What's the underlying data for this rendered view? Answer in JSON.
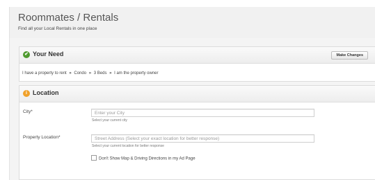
{
  "header": {
    "title": "Roommates / Rentals",
    "subtitle": "Find all your Local Rentals in one place"
  },
  "need": {
    "title": "Your Need",
    "make_changes_label": "Make Changes",
    "summary": [
      "I have a property to rent",
      "Condo",
      "3 Beds",
      "I am the property owner"
    ],
    "separator": "»"
  },
  "location": {
    "title": "Location",
    "city": {
      "label": "City*",
      "placeholder": "Enter your City",
      "help": "Select your current city"
    },
    "property": {
      "label": "Property Location*",
      "placeholder": "Street Address (Select your exact location for better response)",
      "help": "Select your current location for better response"
    },
    "checkbox_label": "Don't Show Map & Driving Directions in my Ad Page"
  },
  "colors": {
    "need_icon": "#4f9a2f",
    "location_icon": "#f0a12a"
  },
  "icons": {
    "need": "check-circle-icon",
    "location": "info-circle-icon"
  }
}
